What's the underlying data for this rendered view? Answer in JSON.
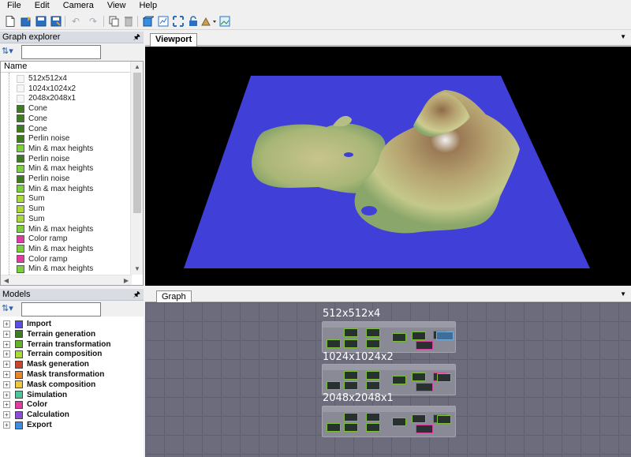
{
  "menu": [
    "File",
    "Edit",
    "Camera",
    "View",
    "Help"
  ],
  "toolbar": {
    "icons": [
      "new-file-icon",
      "open-icon",
      "save-icon",
      "save-as-icon",
      "undo-icon",
      "redo-icon",
      "copy-icon",
      "delete-icon",
      "cube-view-icon",
      "export-icon",
      "fit-view-icon",
      "lock-icon",
      "render-mode-icon",
      "screenshot-icon"
    ]
  },
  "graph_explorer": {
    "title": "Graph explorer",
    "filter_value": "",
    "column_header": "Name",
    "items": [
      {
        "label": "512x512x4",
        "color": ""
      },
      {
        "label": "1024x1024x2",
        "color": ""
      },
      {
        "label": "2048x2048x1",
        "color": ""
      },
      {
        "label": "Cone",
        "color": "#3c7d1e"
      },
      {
        "label": "Cone",
        "color": "#3c7d1e"
      },
      {
        "label": "Cone",
        "color": "#3c7d1e"
      },
      {
        "label": "Perlin noise",
        "color": "#3c7d1e"
      },
      {
        "label": "Min & max heights",
        "color": "#7ad13a"
      },
      {
        "label": "Perlin noise",
        "color": "#3c7d1e"
      },
      {
        "label": "Min & max heights",
        "color": "#7ad13a"
      },
      {
        "label": "Perlin noise",
        "color": "#3c7d1e"
      },
      {
        "label": "Min & max heights",
        "color": "#7ad13a"
      },
      {
        "label": "Sum",
        "color": "#a8da3a"
      },
      {
        "label": "Sum",
        "color": "#a8da3a"
      },
      {
        "label": "Sum",
        "color": "#a8da3a"
      },
      {
        "label": "Min & max heights",
        "color": "#7ad13a"
      },
      {
        "label": "Color ramp",
        "color": "#e23aa0"
      },
      {
        "label": "Min & max heights",
        "color": "#7ad13a"
      },
      {
        "label": "Color ramp",
        "color": "#e23aa0"
      },
      {
        "label": "Min & max heights",
        "color": "#7ad13a"
      }
    ]
  },
  "models": {
    "title": "Models",
    "filter_value": "",
    "items": [
      {
        "label": "Import",
        "color": "#5b4ee8"
      },
      {
        "label": "Terrain generation",
        "color": "#3c7d1e"
      },
      {
        "label": "Terrain transformation",
        "color": "#62b32a"
      },
      {
        "label": "Terrain composition",
        "color": "#a8da3a"
      },
      {
        "label": "Mask generation",
        "color": "#c8452a"
      },
      {
        "label": "Mask transformation",
        "color": "#e8852a"
      },
      {
        "label": "Mask composition",
        "color": "#f0c63a"
      },
      {
        "label": "Simulation",
        "color": "#52c49a"
      },
      {
        "label": "Color",
        "color": "#e23aa0"
      },
      {
        "label": "Calculation",
        "color": "#8a4ed8"
      },
      {
        "label": "Export",
        "color": "#3a8de0"
      }
    ]
  },
  "viewport": {
    "tab": "Viewport"
  },
  "graph": {
    "tab": "Graph",
    "groups": [
      {
        "title": "512x512x4"
      },
      {
        "title": "1024x1024x2"
      },
      {
        "title": "2048x2048x1"
      }
    ]
  }
}
